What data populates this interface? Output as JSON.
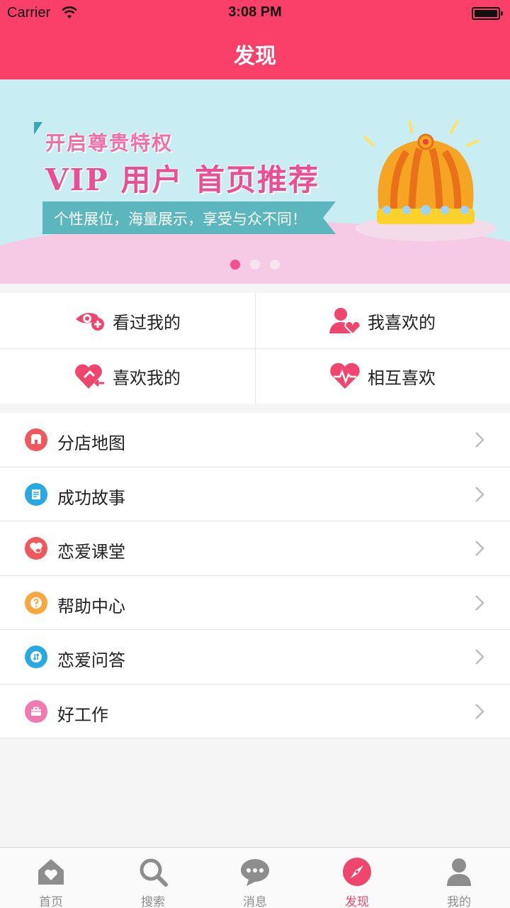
{
  "status": {
    "carrier": "Carrier",
    "time": "3:08 PM"
  },
  "header": {
    "title": "发现"
  },
  "banner": {
    "line1": "开启尊贵特权",
    "line2": "VIP 用户 首页推荐",
    "ribbon": "个性展位，海量展示，享受与众不同！",
    "pages": 3,
    "active_page": 1
  },
  "grid": [
    {
      "label": "看过我的",
      "icon": "eye-plus-icon"
    },
    {
      "label": "我喜欢的",
      "icon": "person-heart-icon"
    },
    {
      "label": "喜欢我的",
      "icon": "heart-arrow-icon"
    },
    {
      "label": "相互喜欢",
      "icon": "heart-pulse-icon"
    }
  ],
  "list": [
    {
      "label": "分店地图",
      "icon": "store-icon",
      "color": "#f0585e"
    },
    {
      "label": "成功故事",
      "icon": "document-icon",
      "color": "#29a9e1"
    },
    {
      "label": "恋爱课堂",
      "icon": "heart-chat-icon",
      "color": "#f0585e"
    },
    {
      "label": "帮助中心",
      "icon": "question-icon",
      "color": "#f8a73f"
    },
    {
      "label": "恋爱问答",
      "icon": "qa-icon",
      "color": "#29a9e1"
    },
    {
      "label": "好工作",
      "icon": "briefcase-icon",
      "color": "#f07ab0"
    }
  ],
  "tabs": [
    {
      "label": "首页",
      "icon": "home-icon"
    },
    {
      "label": "搜索",
      "icon": "search-icon"
    },
    {
      "label": "消息",
      "icon": "message-icon"
    },
    {
      "label": "发现",
      "icon": "compass-icon",
      "active": true
    },
    {
      "label": "我的",
      "icon": "profile-icon"
    }
  ],
  "colors": {
    "accent": "#fa3f68",
    "background": "#f5f5f5"
  }
}
